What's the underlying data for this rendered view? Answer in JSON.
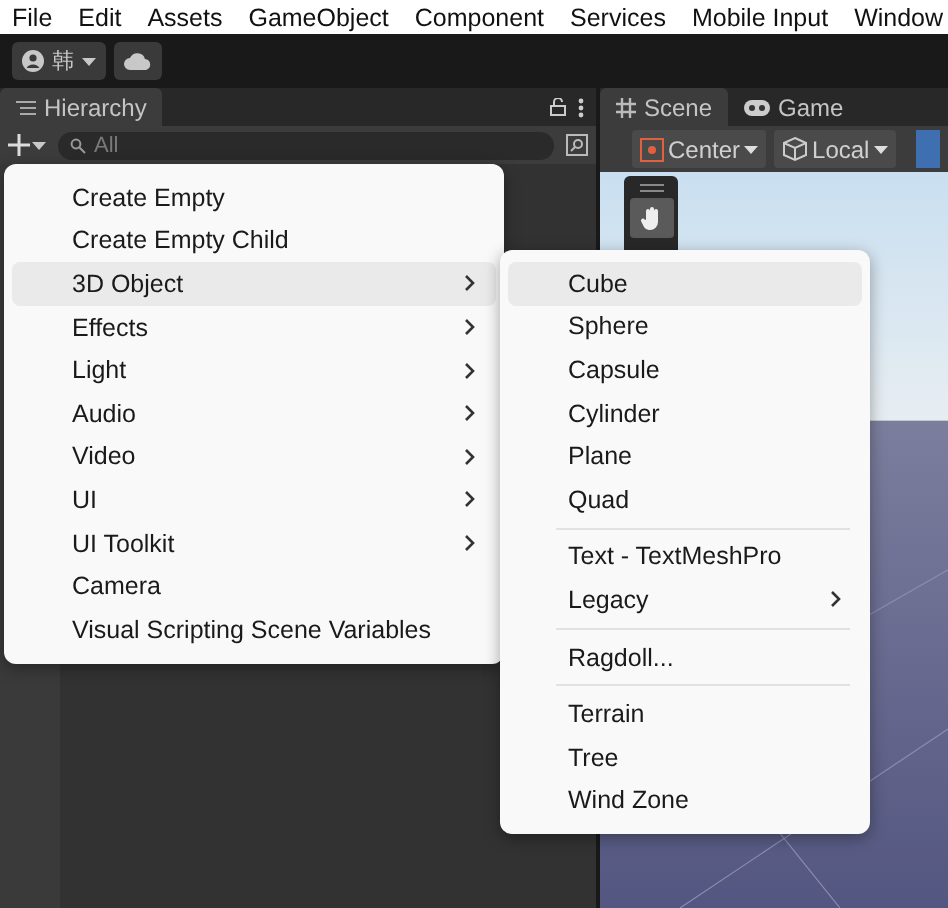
{
  "menu_bar": [
    "File",
    "Edit",
    "Assets",
    "GameObject",
    "Component",
    "Services",
    "Mobile Input",
    "Window"
  ],
  "toolbar": {
    "account": "韩"
  },
  "hierarchy": {
    "title": "Hierarchy",
    "search": {
      "placeholder": "All"
    }
  },
  "scene": {
    "tabs": [
      {
        "label": "Scene",
        "selected": true,
        "kind": "grid"
      },
      {
        "label": "Game",
        "selected": false,
        "kind": "gamepad"
      }
    ],
    "pivot": "Center",
    "space": "Local"
  },
  "context_menu": {
    "items": [
      {
        "label": "Create Empty",
        "kind": "item",
        "selected": false
      },
      {
        "label": "Create Empty Child",
        "kind": "item",
        "selected": false
      },
      {
        "label": "3D Object",
        "kind": "submenu",
        "selected": true
      },
      {
        "label": "Effects",
        "kind": "submenu",
        "selected": false
      },
      {
        "label": "Light",
        "kind": "submenu",
        "selected": false
      },
      {
        "label": "Audio",
        "kind": "submenu",
        "selected": false
      },
      {
        "label": "Video",
        "kind": "submenu",
        "selected": false
      },
      {
        "label": "UI",
        "kind": "submenu",
        "selected": false
      },
      {
        "label": "UI Toolkit",
        "kind": "submenu",
        "selected": false
      },
      {
        "label": "Camera",
        "kind": "item",
        "selected": false
      },
      {
        "label": "Visual Scripting Scene Variables",
        "kind": "item",
        "selected": false
      }
    ]
  },
  "submenu": {
    "groups": [
      {
        "items": [
          {
            "label": "Cube",
            "kind": "item",
            "selected": true
          },
          {
            "label": "Sphere",
            "kind": "item",
            "selected": false
          },
          {
            "label": "Capsule",
            "kind": "item",
            "selected": false
          },
          {
            "label": "Cylinder",
            "kind": "item",
            "selected": false
          },
          {
            "label": "Plane",
            "kind": "item",
            "selected": false
          },
          {
            "label": "Quad",
            "kind": "item",
            "selected": false
          }
        ]
      },
      {
        "items": [
          {
            "label": "Text - TextMeshPro",
            "kind": "item",
            "selected": false
          },
          {
            "label": "Legacy",
            "kind": "submenu",
            "selected": false
          }
        ]
      },
      {
        "items": [
          {
            "label": "Ragdoll...",
            "kind": "item",
            "selected": false
          }
        ]
      },
      {
        "items": [
          {
            "label": "Terrain",
            "kind": "item",
            "selected": false
          },
          {
            "label": "Tree",
            "kind": "item",
            "selected": false
          },
          {
            "label": "Wind Zone",
            "kind": "item",
            "selected": false
          }
        ]
      }
    ]
  }
}
